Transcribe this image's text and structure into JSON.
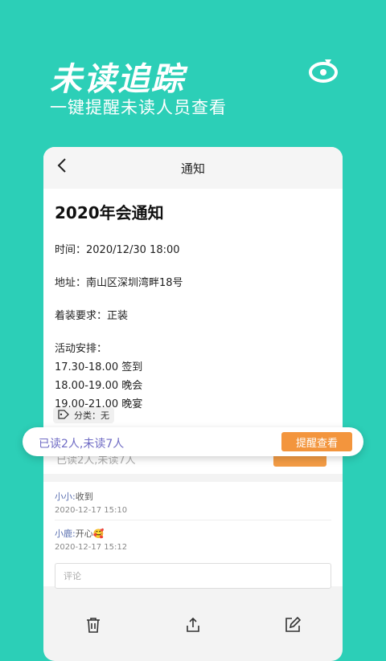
{
  "hero": {
    "title": "未读追踪",
    "subtitle": "一键提醒未读人员查看"
  },
  "nav": {
    "title": "通知"
  },
  "notice": {
    "title": "2020年会通知",
    "time_line": "时间：2020/12/30 18:00",
    "address_line": "地址：南山区深圳湾畔18号",
    "dress_line": "着装要求：正装",
    "schedule_heading": "活动安排：",
    "schedule": [
      "17.30-18.00 签到",
      "18.00-19.00 晚会",
      "19.00-21.00 晚宴"
    ],
    "category_tag": "分类：无"
  },
  "comments": [
    {
      "name": "小小:",
      "text": "收到",
      "time": "2020-12-17 15:10"
    },
    {
      "name": "小鹿:",
      "text": "开心🥰",
      "time": "2020-12-17 15:12"
    }
  ],
  "comment_input": {
    "placeholder": "评论"
  },
  "popup": {
    "read_status": "已读2人,未读7人",
    "remind_button": "提醒查看"
  },
  "icons": {
    "back": "chevron-left-icon",
    "trash": "trash-icon",
    "share": "share-icon",
    "edit": "edit-icon",
    "tag": "tag-icon",
    "logo": "brand-logo-icon"
  },
  "colors": {
    "background": "#2ccfb7",
    "accent_button": "#f3953d",
    "status_text": "#6f6bc4"
  }
}
